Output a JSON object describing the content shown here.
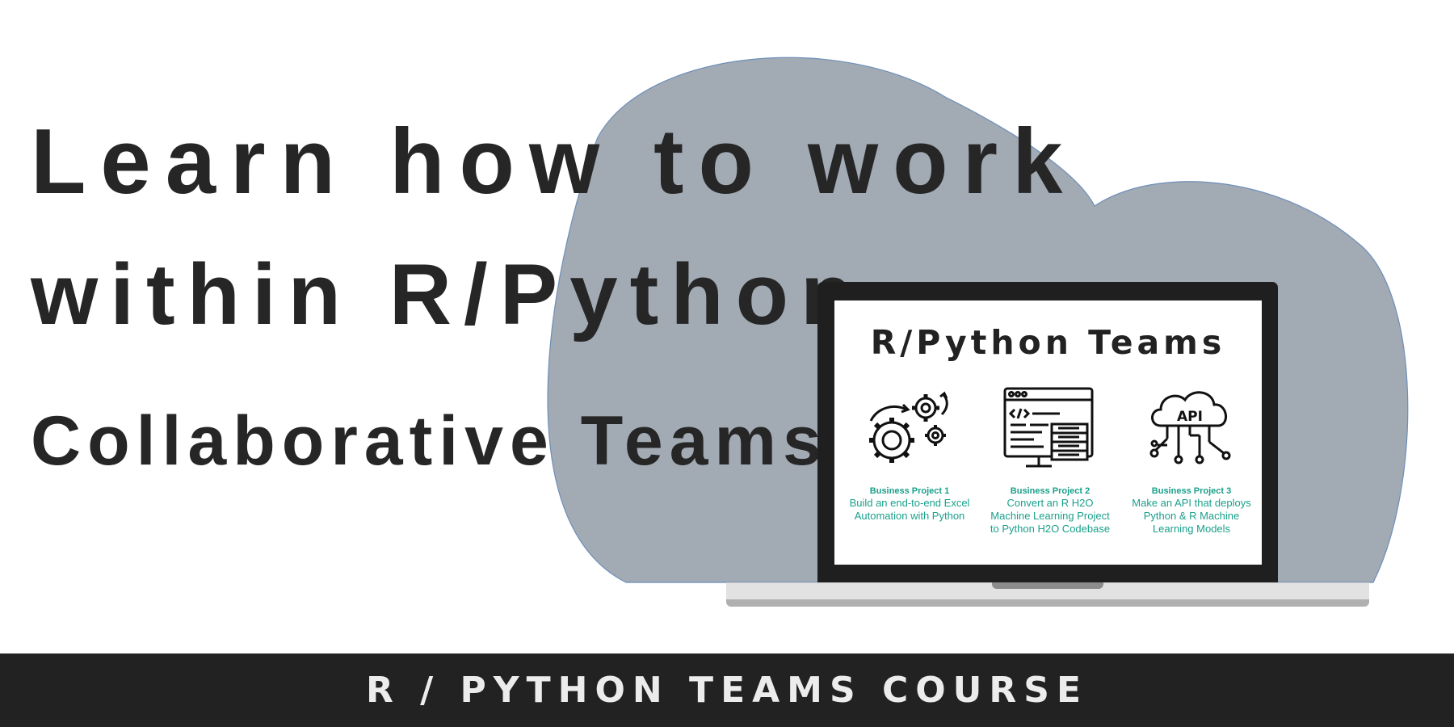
{
  "headline": {
    "line1": "Learn how to work",
    "line2": "within R/Python",
    "line3": "Collaborative Teams"
  },
  "laptop_screen": {
    "title": "R/Python Teams",
    "projects": [
      {
        "icon": "gears-icon",
        "title": "Business Project 1",
        "description": [
          "Build an end-to-end Excel",
          "Automation with Python"
        ]
      },
      {
        "icon": "code-server-icon",
        "title": "Business Project 2",
        "description": [
          "Convert an R H2O",
          "Machine Learning Project",
          "to Python H2O Codebase"
        ]
      },
      {
        "icon": "api-cloud-icon",
        "title": "Business Project 3",
        "description": [
          "Make an API that deploys",
          "Python & R Machine",
          "Learning Models"
        ]
      }
    ]
  },
  "footer": {
    "label": "R / PYTHON TEAMS COURSE"
  },
  "colors": {
    "cloud": "#a2aab3",
    "headline_text": "#262626",
    "accent_teal": "#1aa08b",
    "footer_bg": "#222222",
    "footer_text": "#ececec",
    "laptop_frame": "#1f1f1f"
  }
}
